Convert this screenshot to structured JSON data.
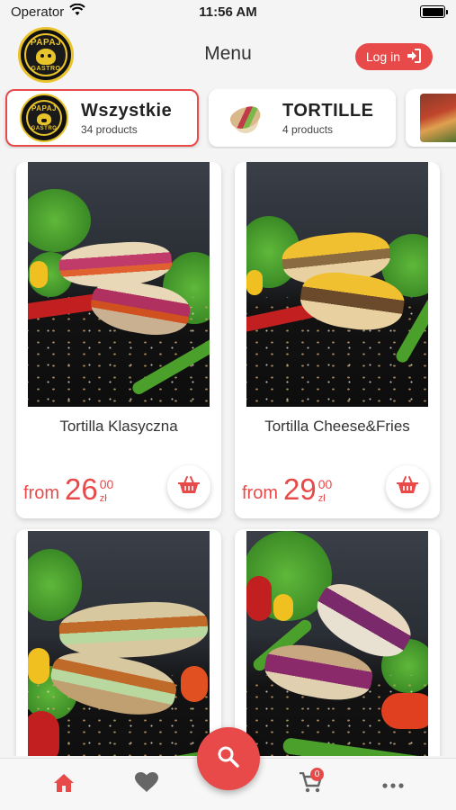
{
  "status_bar": {
    "carrier": "Operator",
    "time": "11:56 AM"
  },
  "header": {
    "title": "Menu",
    "login_label": "Log in",
    "logo_text_top": "PAPAJ",
    "logo_text_bottom": "GASTRO"
  },
  "categories": [
    {
      "name": "Wszystkie",
      "count": "34 products",
      "active": true
    },
    {
      "name": "TORTILLE",
      "count": "4 products",
      "active": false
    },
    {
      "name": "",
      "count": "",
      "active": false
    }
  ],
  "products": [
    {
      "name": "Tortilla Klasyczna",
      "from": "from",
      "price_main": "26",
      "price_cents": "00",
      "currency": "zł"
    },
    {
      "name": "Tortilla Cheese&Fries",
      "from": "from",
      "price_main": "29",
      "price_cents": "00",
      "currency": "zł"
    },
    {
      "name": "",
      "from": "",
      "price_main": "",
      "price_cents": "",
      "currency": ""
    },
    {
      "name": "",
      "from": "",
      "price_main": "",
      "price_cents": "",
      "currency": ""
    }
  ],
  "tabbar": {
    "cart_count": "0"
  },
  "colors": {
    "accent": "#e84a4a",
    "logo_gold": "#e8c42a"
  },
  "icons": [
    "wifi-icon",
    "battery-icon",
    "login-arrow-icon",
    "basket-icon",
    "home-icon",
    "heart-icon",
    "search-icon",
    "cart-icon",
    "more-icon"
  ]
}
